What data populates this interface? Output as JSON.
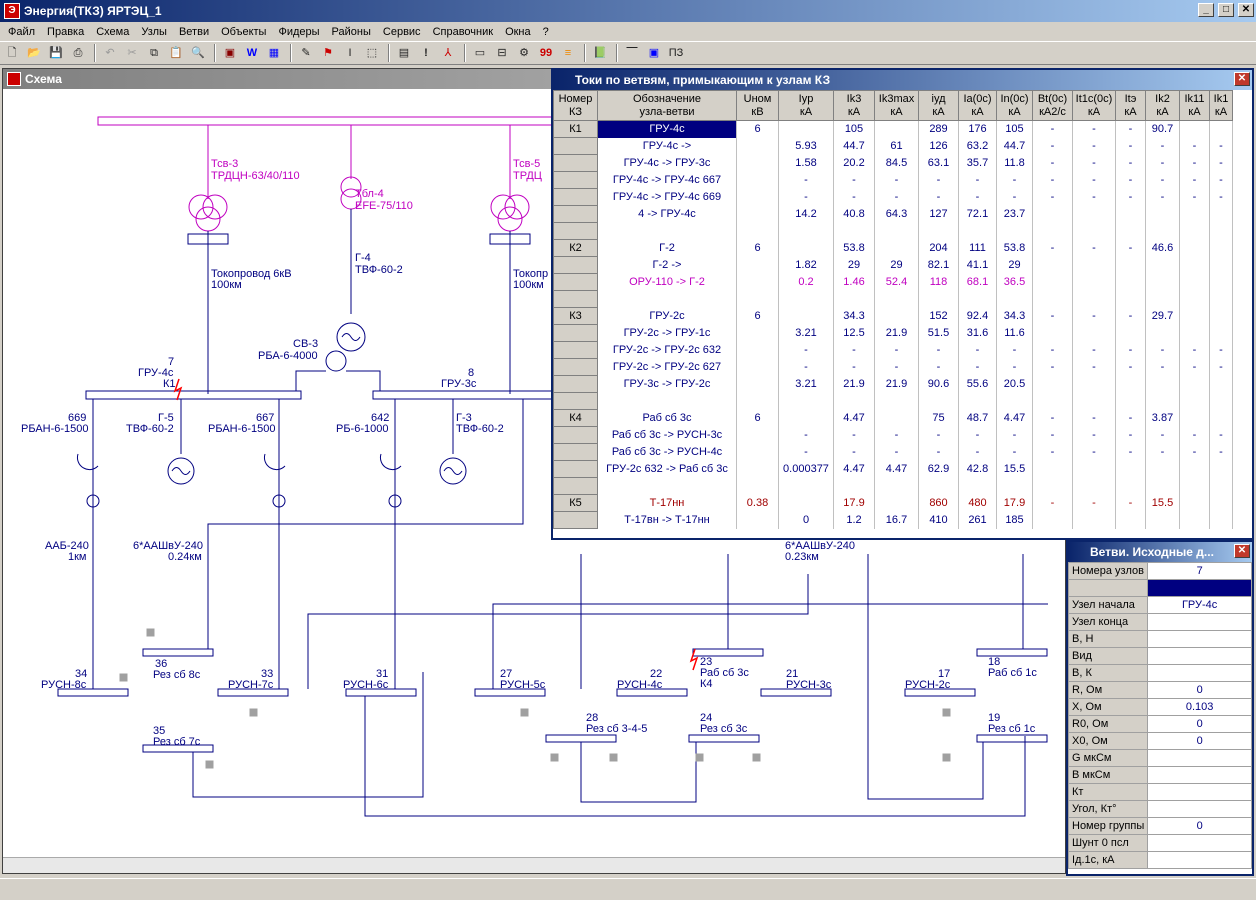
{
  "app": {
    "title": "Энергия(ТКЗ) ЯРТЭЦ_1"
  },
  "menu": [
    "Файл",
    "Правка",
    "Схема",
    "Узлы",
    "Ветви",
    "Объекты",
    "Фидеры",
    "Районы",
    "Сервис",
    "Справочник",
    "Окна",
    "?"
  ],
  "scheme": {
    "title": "Схема",
    "bus_labels": [
      {
        "num": "7",
        "name": "ГРУ-4с"
      },
      {
        "num": "8",
        "name": "ГРУ-3с"
      },
      {
        "num": "34",
        "name": "РУСН-8с"
      },
      {
        "num": "36",
        "name": "Рез сб 8с"
      },
      {
        "num": "33",
        "name": "РУСН-7с"
      },
      {
        "num": "31",
        "name": "РУСН-6с"
      },
      {
        "num": "35",
        "name": "Рез сб 7с"
      },
      {
        "num": "27",
        "name": "РУСН-5с"
      },
      {
        "num": "22",
        "name": "РУСН-4с"
      },
      {
        "num": "23",
        "name": "Раб сб 3с"
      },
      {
        "num": "21",
        "name": "РУСН-3с"
      },
      {
        "num": "28",
        "name": "Рез сб 3-4-5"
      },
      {
        "num": "24",
        "name": "Рез сб 3с"
      },
      {
        "num": "17",
        "name": "РУСН-2с"
      },
      {
        "num": "18",
        "name": "Раб сб 1с"
      },
      {
        "num": "19",
        "name": "Рез сб 1с"
      }
    ],
    "equipment": [
      {
        "name": "Тсв-3",
        "type": "ТРДЦН-63/40/110"
      },
      {
        "name": "Тбл-4",
        "type": "EFE-75/110"
      },
      {
        "name": "Тсв-5",
        "type": "ТРДЦ"
      },
      {
        "name": "Г-4",
        "type": "ТВФ-60-2"
      },
      {
        "name": "Г-5",
        "type": "ТВФ-60-2"
      },
      {
        "name": "Г-3",
        "type": "ТВФ-60-2"
      },
      {
        "name": "Токопровод 6кВ",
        "type": "100км"
      },
      {
        "name": "Токопр",
        "type": "100км"
      },
      {
        "name": "СВ-3",
        "type": "РБА-6-4000"
      },
      {
        "name": "669",
        "type": "РБАН-6-1500"
      },
      {
        "name": "667",
        "type": "РБАН-6-1500"
      },
      {
        "name": "642",
        "type": "РБ-6-1000"
      },
      {
        "name": "ААБ-240",
        "type": "1км"
      },
      {
        "name": "6*ААШвУ-240",
        "type": "0.24км"
      },
      {
        "name": "6*ААШвУ-240",
        "type": "0.23км"
      },
      {
        "name": "К1",
        "type": ""
      },
      {
        "name": "К4",
        "type": ""
      }
    ]
  },
  "currents": {
    "title": "Токи по ветвям, примыкающим к узлам КЗ",
    "headers": [
      [
        "Номер",
        "КЗ"
      ],
      [
        "Обозначение",
        "узла-ветви"
      ],
      [
        "Uном",
        "кВ"
      ],
      [
        "Iуp",
        "кА"
      ],
      [
        "Ik3",
        "кА"
      ],
      [
        "Ik3max",
        "кА"
      ],
      [
        "iуд",
        "кА"
      ],
      [
        "Ia(0c)",
        "кА"
      ],
      [
        "In(0c)",
        "кА"
      ],
      [
        "Bt(0c)",
        "кА2/с"
      ],
      [
        "It1c(0c)",
        "кА"
      ],
      [
        "Itэ",
        "кА"
      ],
      [
        "Ik2",
        "кА"
      ],
      [
        "Ik11",
        "кА"
      ],
      [
        "Ik1",
        "кА"
      ]
    ],
    "rows": [
      [
        "К1",
        "ГРУ-4с",
        "6",
        "",
        "105",
        "",
        "289",
        "176",
        "105",
        "-",
        "-",
        "-",
        "90.7",
        "",
        ""
      ],
      [
        "",
        "ГРУ-4с ->",
        "",
        "5.93",
        "44.7",
        "61",
        "126",
        "63.2",
        "44.7",
        "-",
        "-",
        "-",
        "-",
        "-",
        "-"
      ],
      [
        "",
        "ГРУ-4с -> ГРУ-3с",
        "",
        "1.58",
        "20.2",
        "84.5",
        "63.1",
        "35.7",
        "11.8",
        "-",
        "-",
        "-",
        "-",
        "-",
        "-"
      ],
      [
        "",
        "ГРУ-4с -> ГРУ-4с 667",
        "",
        "-",
        "-",
        "-",
        "-",
        "-",
        "-",
        "-",
        "-",
        "-",
        "-",
        "-",
        "-"
      ],
      [
        "",
        "ГРУ-4с -> ГРУ-4с 669",
        "",
        "-",
        "-",
        "-",
        "-",
        "-",
        "-",
        "-",
        "-",
        "-",
        "-",
        "-",
        "-"
      ],
      [
        "",
        "4 -> ГРУ-4с",
        "",
        "14.2",
        "40.8",
        "64.3",
        "127",
        "72.1",
        "23.7",
        "",
        "",
        "",
        "",
        "",
        ""
      ],
      [
        "",
        "",
        "",
        "",
        "",
        "",
        "",
        "",
        "",
        "",
        "",
        "",
        "",
        "",
        ""
      ],
      [
        "К2",
        "Г-2",
        "6",
        "",
        "53.8",
        "",
        "204",
        "111",
        "53.8",
        "-",
        "-",
        "-",
        "46.6",
        "",
        ""
      ],
      [
        "",
        "Г-2 ->",
        "",
        "1.82",
        "29",
        "29",
        "82.1",
        "41.1",
        "29",
        "",
        "",
        "",
        "",
        "",
        ""
      ],
      [
        "",
        "ОРУ-110 -> Г-2",
        "",
        "0.2",
        "1.46",
        "52.4",
        "118",
        "68.1",
        "36.5",
        "",
        "",
        "",
        "",
        "",
        ""
      ],
      [
        "",
        "",
        "",
        "",
        "",
        "",
        "",
        "",
        "",
        "",
        "",
        "",
        "",
        "",
        ""
      ],
      [
        "К3",
        "ГРУ-2с",
        "6",
        "",
        "34.3",
        "",
        "152",
        "92.4",
        "34.3",
        "-",
        "-",
        "-",
        "29.7",
        "",
        ""
      ],
      [
        "",
        "ГРУ-2с -> ГРУ-1с",
        "",
        "3.21",
        "12.5",
        "21.9",
        "51.5",
        "31.6",
        "11.6",
        "",
        "",
        "",
        "",
        "",
        ""
      ],
      [
        "",
        "ГРУ-2с -> ГРУ-2с 632",
        "",
        "-",
        "-",
        "-",
        "-",
        "-",
        "-",
        "-",
        "-",
        "-",
        "-",
        "-",
        "-"
      ],
      [
        "",
        "ГРУ-2с -> ГРУ-2с 627",
        "",
        "-",
        "-",
        "-",
        "-",
        "-",
        "-",
        "-",
        "-",
        "-",
        "-",
        "-",
        "-"
      ],
      [
        "",
        "ГРУ-3с -> ГРУ-2с",
        "",
        "3.21",
        "21.9",
        "21.9",
        "90.6",
        "55.6",
        "20.5",
        "",
        "",
        "",
        "",
        "",
        ""
      ],
      [
        "",
        "",
        "",
        "",
        "",
        "",
        "",
        "",
        "",
        "",
        "",
        "",
        "",
        "",
        ""
      ],
      [
        "К4",
        "Раб сб 3с",
        "6",
        "",
        "4.47",
        "",
        "75",
        "48.7",
        "4.47",
        "-",
        "-",
        "-",
        "3.87",
        "",
        ""
      ],
      [
        "",
        "Раб сб 3с -> РУСН-3с",
        "",
        "-",
        "-",
        "-",
        "-",
        "-",
        "-",
        "-",
        "-",
        "-",
        "-",
        "-",
        "-"
      ],
      [
        "",
        "Раб сб 3с -> РУСН-4с",
        "",
        "-",
        "-",
        "-",
        "-",
        "-",
        "-",
        "-",
        "-",
        "-",
        "-",
        "-",
        "-"
      ],
      [
        "",
        "ГРУ-2с 632 -> Раб сб 3с",
        "",
        "0.000377",
        "4.47",
        "4.47",
        "62.9",
        "42.8",
        "15.5",
        "",
        "",
        "",
        "",
        "",
        ""
      ],
      [
        "",
        "",
        "",
        "",
        "",
        "",
        "",
        "",
        "",
        "",
        "",
        "",
        "",
        "",
        ""
      ],
      [
        "К5",
        "Т-17нн",
        "0.38",
        "",
        "17.9",
        "",
        "860",
        "480",
        "17.9",
        "-",
        "-",
        "-",
        "15.5",
        "",
        ""
      ],
      [
        "",
        "Т-17вн -> Т-17нн",
        "",
        "0",
        "1.2",
        "16.7",
        "410",
        "261",
        "185",
        "",
        "",
        "",
        "",
        "",
        ""
      ]
    ]
  },
  "branch": {
    "title": "Ветви. Исходные д...",
    "rows": [
      {
        "label": "Номера узлов",
        "value": "7"
      },
      {
        "label": "",
        "value": ""
      },
      {
        "label": "Узел начала",
        "value": "ГРУ-4с"
      },
      {
        "label": "Узел конца",
        "value": ""
      },
      {
        "label": "В, Н",
        "value": ""
      },
      {
        "label": "Вид",
        "value": ""
      },
      {
        "label": "В, К",
        "value": ""
      },
      {
        "label": "R, Ом",
        "value": "0"
      },
      {
        "label": "X, Ом",
        "value": "0.103"
      },
      {
        "label": "R0, Ом",
        "value": "0"
      },
      {
        "label": "X0, Ом",
        "value": "0"
      },
      {
        "label": "G мкСм",
        "value": ""
      },
      {
        "label": "B мкСм",
        "value": ""
      },
      {
        "label": "Кт",
        "value": ""
      },
      {
        "label": "Угол, Кт°",
        "value": ""
      },
      {
        "label": "Номер группы",
        "value": "0"
      },
      {
        "label": "Шунт 0 псл",
        "value": ""
      },
      {
        "label": "Iд.1с, кА",
        "value": ""
      }
    ]
  },
  "colors": {
    "titlebar": "#0a246a",
    "scheme_line": "#000080",
    "transformer": "#c000c0",
    "selection": "#000080",
    "fault": "#ff0000"
  }
}
